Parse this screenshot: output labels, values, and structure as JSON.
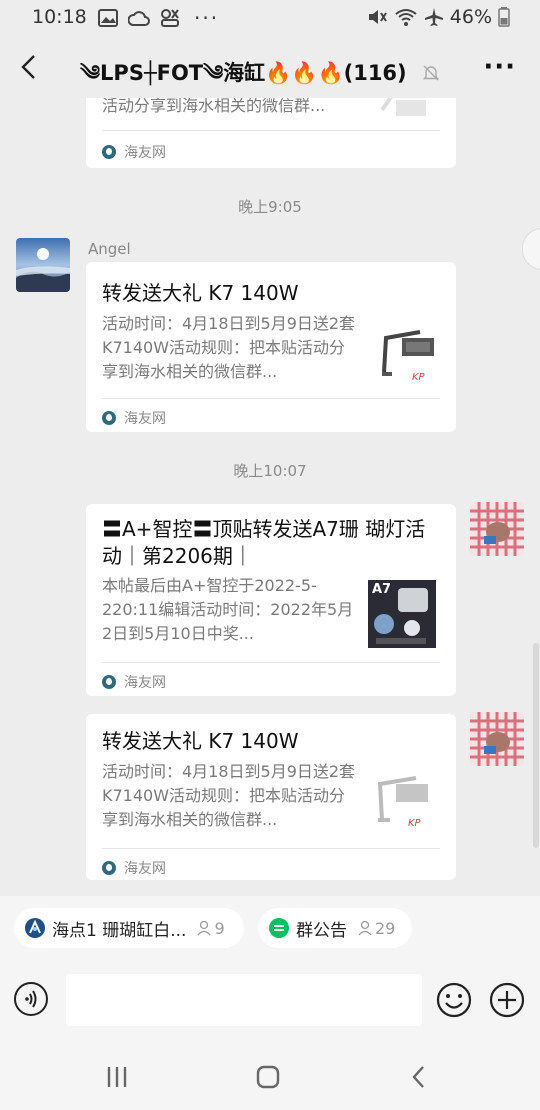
{
  "status_bar": {
    "time": "10:18",
    "battery_percent": "46%",
    "left_icons": [
      "gallery-icon",
      "cloud-icon",
      "game-icon",
      "more-dots-icon"
    ],
    "right_icons": [
      "mute-icon",
      "wifi-icon",
      "airplane-icon",
      "battery-icon"
    ]
  },
  "header": {
    "title": "༄LPS┼FOT༄海缸🔥🔥🔥(116)",
    "muted_icon": "bell-off-icon"
  },
  "chat": {
    "top_card": {
      "desc_tail": "活动分享到海水相关的微信群...",
      "source": "海友网"
    },
    "time_1": "晚上9:05",
    "msg_angel": {
      "sender": "Angel",
      "title": "转发送大礼 K7 140W",
      "desc": "活动时间：4月18日到5月9日送2套K7140W活动规则：把本贴活动分享到海水相关的微信群...",
      "source": "海友网"
    },
    "time_2": "晚上10:07",
    "msg_self_1": {
      "title": "〓A+智控〓顶贴转发送A7珊 瑚灯活动｜第2206期｜",
      "desc": "本帖最后由A+智控于2022-5-220:11编辑活动时间：2022年5月2日到5月10日中奖...",
      "thumb_label": "A7",
      "source": "海友网"
    },
    "msg_self_2": {
      "title": "转发送大礼 K7 140W",
      "desc": "活动时间：4月18日到5月9日送2套K7140W活动规则：把本贴活动分享到海水相关的微信群...",
      "source": "海友网"
    }
  },
  "shortcuts": [
    {
      "label": "海点1 珊瑚缸白...",
      "count": "9"
    },
    {
      "label": "群公告",
      "count": "29"
    }
  ],
  "input": {
    "placeholder": ""
  },
  "colors": {
    "background": "#ededed",
    "card": "#ffffff",
    "source_icon": "#2f6a7c",
    "notice_green": "#07c160"
  }
}
